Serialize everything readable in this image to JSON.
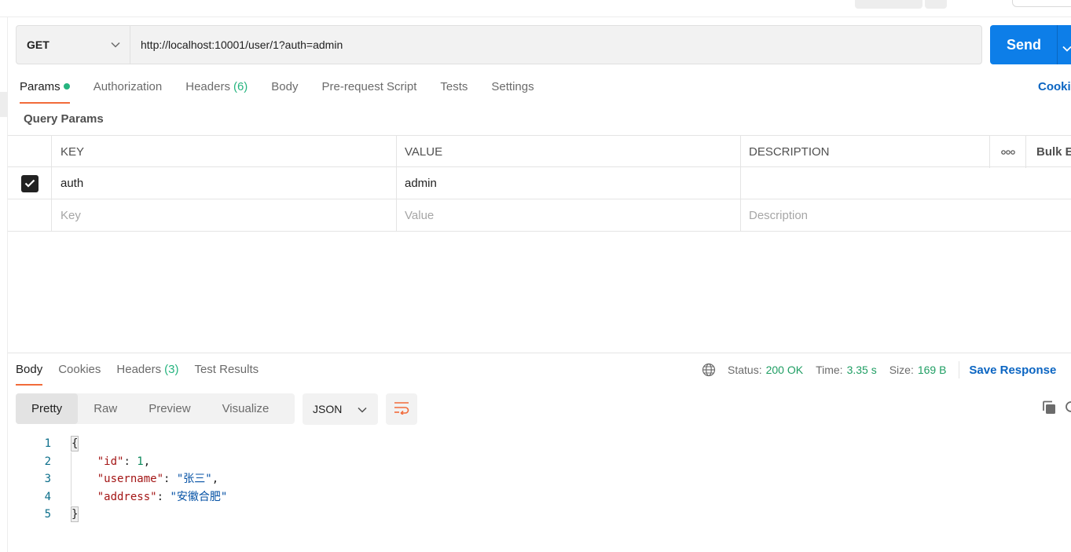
{
  "request": {
    "method": "GET",
    "url": "http://localhost:10001/user/1?auth=admin",
    "send_label": "Send"
  },
  "request_tabs": [
    {
      "label": "Params",
      "active": true
    },
    {
      "label": "Authorization"
    },
    {
      "label": "Headers",
      "count": "(6)"
    },
    {
      "label": "Body"
    },
    {
      "label": "Pre-request Script"
    },
    {
      "label": "Tests"
    },
    {
      "label": "Settings"
    }
  ],
  "cookies_link": "Cooki",
  "query_params": {
    "title": "Query Params",
    "headers": {
      "key": "KEY",
      "value": "VALUE",
      "description": "DESCRIPTION",
      "more": "ooo",
      "bulk_edit": "Bulk E"
    },
    "rows": [
      {
        "checked": true,
        "key": "auth",
        "value": "admin",
        "description": ""
      }
    ],
    "placeholders": {
      "key": "Key",
      "value": "Value",
      "description": "Description"
    }
  },
  "response_tabs": [
    {
      "label": "Body",
      "active": true
    },
    {
      "label": "Cookies"
    },
    {
      "label": "Headers",
      "count": "(3)"
    },
    {
      "label": "Test Results"
    }
  ],
  "response_meta": {
    "status_label": "Status:",
    "status": "200 OK",
    "time_label": "Time:",
    "time": "3.35 s",
    "size_label": "Size:",
    "size": "169 B",
    "save_label": "Save Response"
  },
  "view_modes": [
    "Pretty",
    "Raw",
    "Preview",
    "Visualize"
  ],
  "active_view": "Pretty",
  "format": "JSON",
  "code_lines": [
    {
      "n": "1"
    },
    {
      "n": "2",
      "key": "\"id\"",
      "value": "1",
      "trail": ","
    },
    {
      "n": "3",
      "key": "\"username\"",
      "value": "\"张三\"",
      "trail": ","
    },
    {
      "n": "4",
      "key": "\"address\"",
      "value": "\"安徽合肥\"",
      "trail": ""
    },
    {
      "n": "5"
    }
  ],
  "colors": {
    "send": "#0d7ee8",
    "active_tab_underline": "#f26b3a",
    "success": "#26b47f",
    "link": "#0b65c2"
  }
}
